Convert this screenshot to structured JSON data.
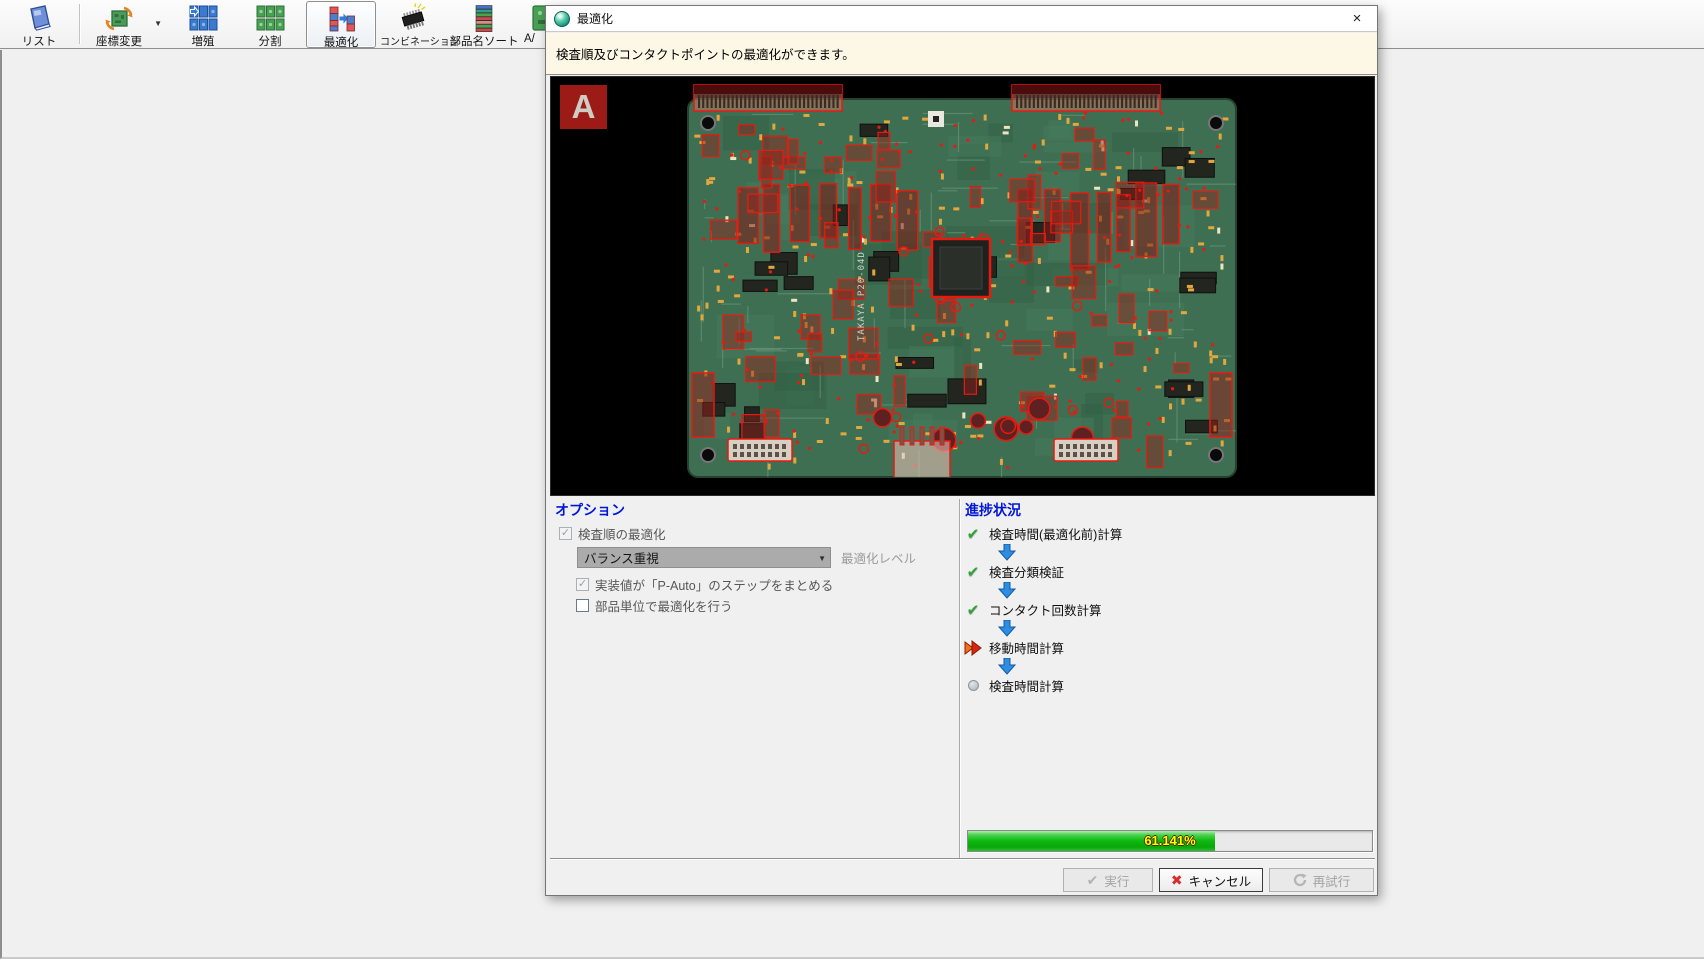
{
  "app": {
    "toolbar": {
      "items": [
        {
          "id": "list",
          "label": "リスト",
          "icon": "list-book-icon"
        },
        {
          "id": "coord",
          "label": "座標変更",
          "icon": "coordinate-change-icon",
          "dropdown": true
        },
        {
          "id": "multiply",
          "label": "増殖",
          "icon": "multiply-boards-icon"
        },
        {
          "id": "split",
          "label": "分割",
          "icon": "split-boards-icon"
        },
        {
          "id": "optimize",
          "label": "最適化",
          "icon": "optimize-bars-icon",
          "pressed": true
        },
        {
          "id": "combination",
          "label": "コンビネーション",
          "icon": "ic-chip-icon"
        },
        {
          "id": "partsort",
          "label": "部品名ソート",
          "icon": "sorted-bars-icon"
        },
        {
          "id": "abside",
          "label": "A/",
          "icon": "board-side-icon",
          "clipped_by_dialog": true
        }
      ]
    }
  },
  "dialog": {
    "title": "最適化",
    "title_icon": "green-sphere-icon",
    "close_glyph": "×",
    "info_text": "検査順及びコンタクトポイントの最適化ができます。",
    "board_side_label": "A",
    "pcb": {
      "silkscreen_text": "TAKAYA P20-04D"
    },
    "options": {
      "header": "オプション",
      "checkboxes": [
        {
          "label": "検査順の最適化",
          "checked": true,
          "enabled": false
        },
        {
          "label": "実装値が「P-Auto」のステップをまとめる",
          "checked": true,
          "enabled": false
        },
        {
          "label": "部品単位で最適化を行う",
          "checked": false,
          "enabled": true
        }
      ],
      "check_glyph": "✓",
      "level_dropdown_value": "バランス重視",
      "dropdown_arrow_glyph": "▼",
      "level_label": "最適化レベル"
    },
    "progress": {
      "header": "進捗状況",
      "steps": [
        {
          "label": "検査時間(最適化前)計算",
          "state": "done",
          "icon": "green-check-icon"
        },
        {
          "label": "検査分類検証",
          "state": "done",
          "icon": "green-check-icon"
        },
        {
          "label": "コンタクト回数計算",
          "state": "done",
          "icon": "green-check-icon"
        },
        {
          "label": "移動時間計算",
          "state": "current",
          "icon": "red-double-arrow-icon"
        },
        {
          "label": "検査時間計算",
          "state": "pending",
          "icon": "gray-circle-icon"
        }
      ],
      "done_glyph": "✔",
      "percent": 61.141,
      "percent_text": "61.141%"
    },
    "buttons": [
      {
        "label": "実行",
        "enabled": false,
        "icon": "check-icon"
      },
      {
        "label": "キャンセル",
        "enabled": true,
        "icon": "red-x-icon"
      },
      {
        "label": "再試行",
        "enabled": false,
        "icon": "retry-arrow-icon"
      }
    ],
    "button_glyphs": {
      "exec": "✔",
      "cancel": "✖"
    }
  },
  "colors": {
    "section_header_blue": "#0016d8",
    "progress_green": "#0db80f",
    "progress_text_yellow": "#ffff00",
    "highlight_red": "#e81a10",
    "board_green": "#3e6f52",
    "info_bar_bg": "#fdf8e6",
    "board_label_bg": "#9c1b17"
  }
}
